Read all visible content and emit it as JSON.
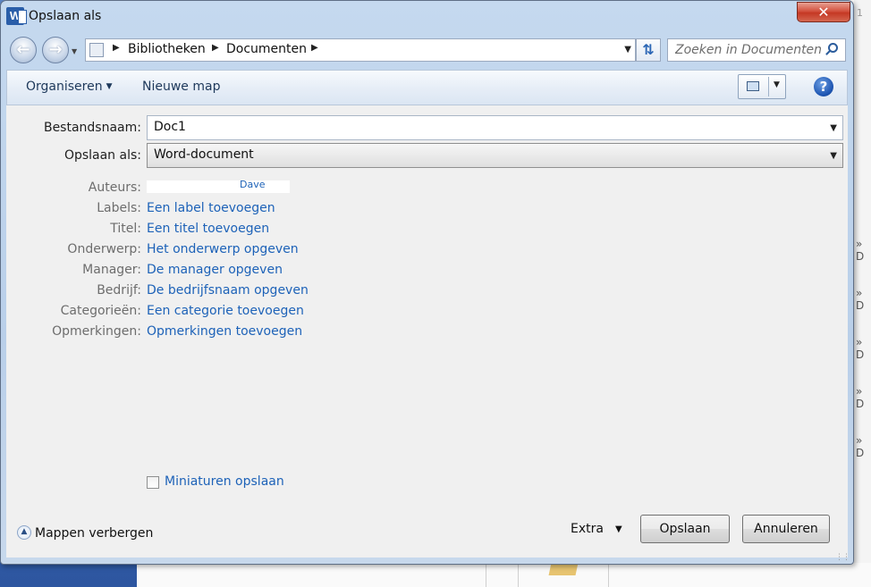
{
  "window": {
    "title": "Opslaan als",
    "app_icon": "word-icon",
    "close_symbol": "✕"
  },
  "nav": {
    "back_icon": "back-arrow-icon",
    "forward_icon": "forward-arrow-icon",
    "breadcrumbs": [
      "Bibliotheken",
      "Documenten"
    ],
    "search_placeholder": "Zoeken in Documenten"
  },
  "toolbar": {
    "organize_label": "Organiseren",
    "new_folder_label": "Nieuwe map",
    "help_label": "?"
  },
  "form": {
    "filename_label": "Bestandsnaam:",
    "filename_value": "Doc1",
    "savetype_label": "Opslaan als:",
    "savetype_value": "Word-document"
  },
  "metadata": [
    {
      "label": "Auteurs:",
      "value": "Dave"
    },
    {
      "label": "Labels:",
      "value": "Een label toevoegen"
    },
    {
      "label": "Titel:",
      "value": "Een titel toevoegen"
    },
    {
      "label": "Onderwerp:",
      "value": "Het onderwerp opgeven"
    },
    {
      "label": "Manager:",
      "value": "De manager opgeven"
    },
    {
      "label": "Bedrijf:",
      "value": "De bedrijfsnaam opgeven"
    },
    {
      "label": "Categorieën:",
      "value": "Een categorie toevoegen"
    },
    {
      "label": "Opmerkingen:",
      "value": "Opmerkingen toevoegen"
    }
  ],
  "thumbnail_label": "Miniaturen opslaan",
  "footer": {
    "hide_folders_label": "Mappen verbergen",
    "extra_label": "Extra",
    "save_button": "Opslaan",
    "cancel_button": "Annuleren"
  },
  "background": {
    "side_marks": [
      "» D",
      "» D",
      "» D",
      "» D",
      "» D"
    ],
    "corner_number": "1"
  },
  "colors": {
    "link": "#1d62b8",
    "label_gray": "#6d6d6d",
    "window_frame": "#c5d9ef"
  }
}
